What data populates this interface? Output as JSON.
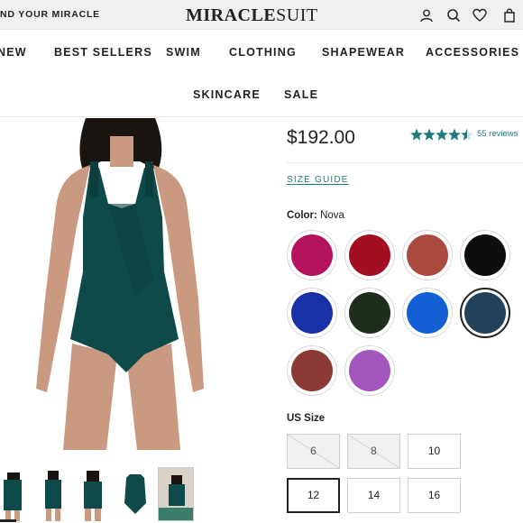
{
  "topbar": {
    "promo_text": "ND YOUR MIRACLE",
    "logo_bold": "MIRACLE",
    "logo_thin": "SUIT",
    "icons": [
      "account-icon",
      "search-icon",
      "wishlist-icon",
      "cart-icon"
    ]
  },
  "nav": {
    "items": [
      "NEW",
      "BEST SELLERS",
      "SWIM",
      "CLOTHING",
      "SHAPEWEAR",
      "ACCESSORIES",
      "SKINCARE",
      "SALE"
    ]
  },
  "product": {
    "price": "$192.00",
    "rating": 4.5,
    "reviews_text": "55 reviews",
    "size_guide_label": "SIZE GUIDE",
    "color_label": "Color:",
    "color_value": "Nova",
    "size_label": "US Size",
    "colors": [
      {
        "hex": "#b5125e",
        "selected": false
      },
      {
        "hex": "#a20e22",
        "selected": false
      },
      {
        "hex": "#ab4a3e",
        "selected": false
      },
      {
        "hex": "#0e0e0e",
        "selected": false
      },
      {
        "hex": "#1831a6",
        "selected": false
      },
      {
        "hex": "#1f2e1c",
        "selected": false
      },
      {
        "hex": "#1360d4",
        "selected": false
      },
      {
        "hex": "#22415a",
        "selected": true
      },
      {
        "hex": "#8c3a35",
        "selected": false
      },
      {
        "hex": "#a256bd",
        "selected": false
      }
    ],
    "sizes": [
      {
        "label": "6",
        "available": false,
        "selected": false
      },
      {
        "label": "8",
        "available": false,
        "selected": false
      },
      {
        "label": "10",
        "available": true,
        "selected": false
      },
      {
        "label": "12",
        "available": true,
        "selected": true
      },
      {
        "label": "14",
        "available": true,
        "selected": false
      },
      {
        "label": "16",
        "available": true,
        "selected": false
      }
    ]
  },
  "theme": {
    "accent": "#1f7a80",
    "swimsuit": "#0f4a4a",
    "skin": "#c99a7f"
  }
}
